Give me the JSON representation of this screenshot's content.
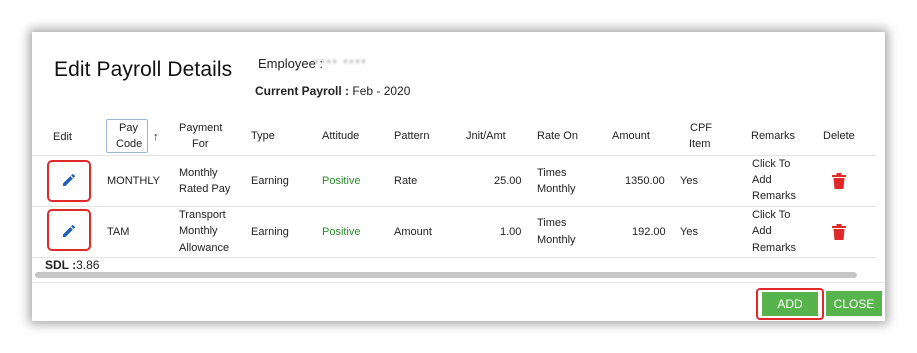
{
  "dialog": {
    "title": "Edit Payroll Details",
    "employee_label": "Employee :",
    "employee_value": "**** ****",
    "current_payroll_label": "Current Payroll :",
    "current_payroll_value": " Feb - 2020"
  },
  "table": {
    "headers": {
      "edit": "Edit",
      "pay_code_1": "Pay",
      "pay_code_2": "Code",
      "payment_for_1": "Payment",
      "payment_for_2": "For",
      "type": "Type",
      "attitude": "Attitude",
      "pattern": "Pattern",
      "unit_amt": "Jnit/Amt",
      "rate_on": "Rate On",
      "amount": "Amount",
      "cpf_1": "CPF",
      "cpf_2": "Item",
      "remarks": "Remarks",
      "delete": "Delete"
    },
    "rows": [
      {
        "pay_code": "MONTHLY",
        "payment_for": [
          "Monthly",
          "Rated Pay"
        ],
        "type": "Earning",
        "attitude": "Positive",
        "pattern": "Rate",
        "unit_amt": "25.00",
        "rate_on": [
          "Times",
          "Monthly"
        ],
        "amount": "1350.00",
        "cpf_item": "Yes",
        "remarks": [
          "Click To",
          "Add",
          "Remarks"
        ]
      },
      {
        "pay_code": "TAM",
        "payment_for": [
          "Transport",
          "Monthly",
          "Allowance"
        ],
        "type": "Earning",
        "attitude": "Positive",
        "pattern": "Amount",
        "unit_amt": "1.00",
        "rate_on": [
          "Times",
          "Monthly"
        ],
        "amount": "192.00",
        "cpf_item": "Yes",
        "remarks": [
          "Click To",
          "Add",
          "Remarks"
        ]
      }
    ]
  },
  "sdl": {
    "label": "SDL :",
    "value": "3.86"
  },
  "buttons": {
    "add": "ADD",
    "close": "CLOSE"
  },
  "colors": {
    "positive": "#2e8b2e",
    "edit_icon": "#1f5fb8",
    "delete_icon": "#e02a2a",
    "button_green": "#57b34c",
    "highlight_red": "#e02a2a"
  },
  "icons": {
    "edit": "pencil-icon",
    "delete": "trash-icon",
    "sort": "sort-arrow-icon"
  }
}
